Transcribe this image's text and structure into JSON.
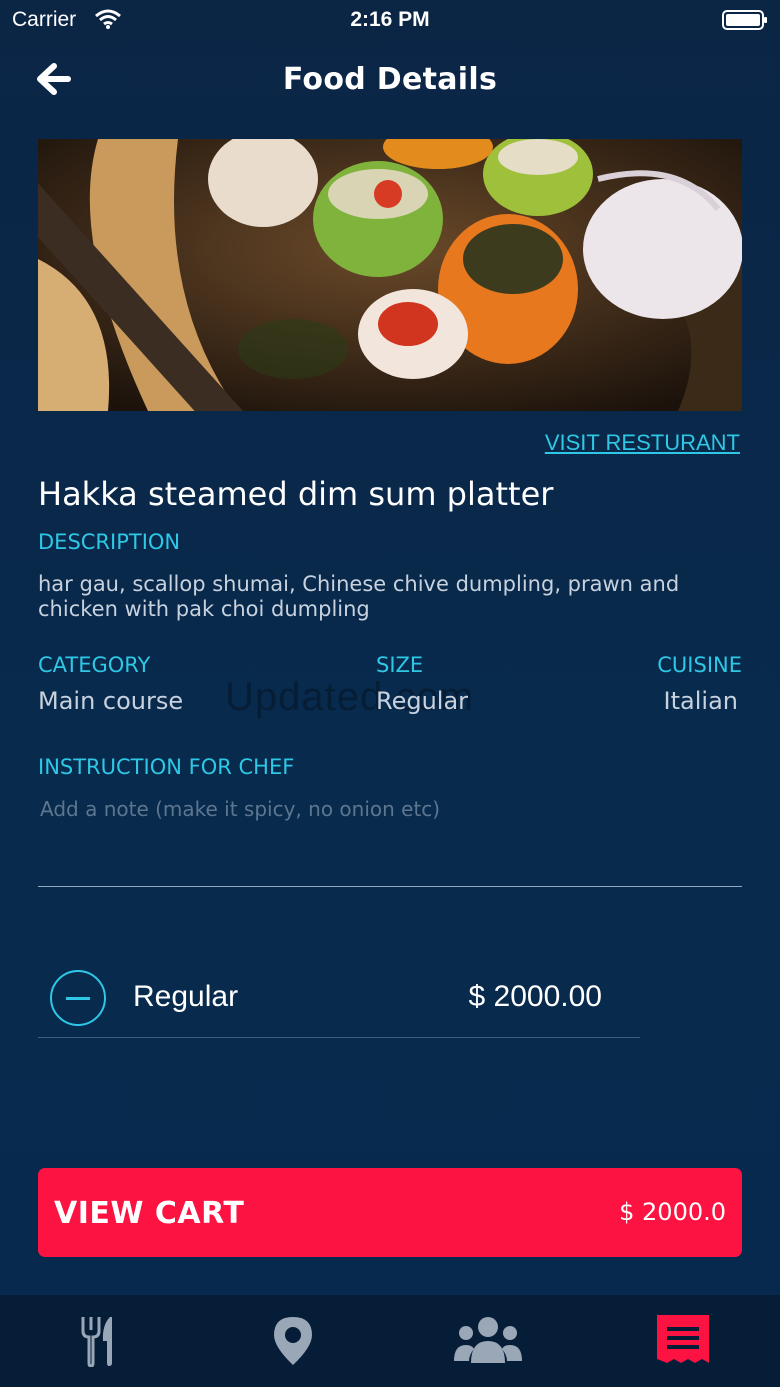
{
  "status_bar": {
    "carrier": "Carrier",
    "time": "2:16 PM"
  },
  "nav": {
    "title": "Food Details",
    "back_icon": "arrow-left-icon"
  },
  "restaurant": {
    "visit_label": "VISIT RESTURANT"
  },
  "food": {
    "name": "Hakka steamed dim sum platter",
    "description_label": "DESCRIPTION",
    "description": "har gau, scallop shumai, Chinese chive dumpling, prawn and chicken with pak choi dumpling",
    "category_label": "CATEGORY",
    "category": "Main course",
    "size_label": "SIZE",
    "size": "Regular",
    "cuisine_label": "CUISINE",
    "cuisine": "Italian"
  },
  "watermark": "Updated.com",
  "instruction": {
    "label": "INSTRUCTION FOR CHEF",
    "placeholder": "Add a note (make it spicy, no onion etc)",
    "value": ""
  },
  "order_item": {
    "name": "Regular",
    "price": "$ 2000.00"
  },
  "cart": {
    "label": "VIEW CART",
    "total": "$ 2000.0"
  },
  "tabs": [
    {
      "name": "menu",
      "icon": "fork-knife-icon",
      "active": false
    },
    {
      "name": "location",
      "icon": "map-pin-icon",
      "active": false
    },
    {
      "name": "people",
      "icon": "group-icon",
      "active": false
    },
    {
      "name": "orders",
      "icon": "receipt-icon",
      "active": true
    }
  ],
  "colors": {
    "accent": "#2ec8e6",
    "cart": "#fc1342",
    "background": "#082a4d"
  }
}
